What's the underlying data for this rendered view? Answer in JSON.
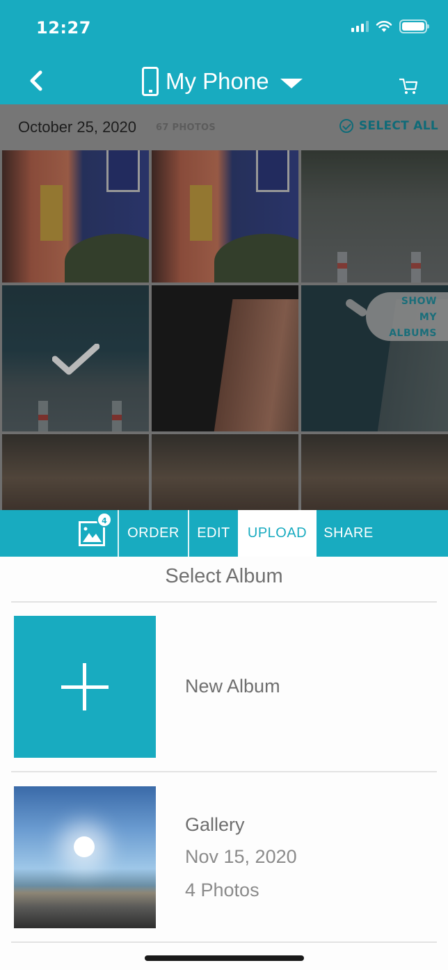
{
  "status_bar": {
    "time": "12:27"
  },
  "header": {
    "title": "My Phone",
    "back_icon": "chevron-left-icon",
    "device_icon": "phone-icon",
    "dropdown_icon": "caret-down-icon",
    "cart_icon": "cart-icon"
  },
  "photo_browser": {
    "date": "October 25, 2020",
    "count": "67 PHOTOS",
    "select_all": "SELECT ALL",
    "show_albums": [
      "SHOW",
      "MY",
      "ALBUMS"
    ],
    "selected_photo_index": 3,
    "photos": [
      "taco-storefront",
      "taco-storefront",
      "night-walkway",
      "string-lights-walkway",
      "brick-tower",
      "brick-tower",
      "hotel-plaza",
      "hotel-plaza",
      "hotel-plaza"
    ]
  },
  "toolbar": {
    "selected_count": "4",
    "items": [
      {
        "label": "ORDER"
      },
      {
        "label": "EDIT"
      },
      {
        "label": "UPLOAD",
        "active": true
      },
      {
        "label": "SHARE"
      }
    ]
  },
  "albums": {
    "title": "Select Album",
    "new_album_label": "New Album",
    "list": [
      {
        "name": "Gallery",
        "date": "Nov 15, 2020",
        "count": "4 Photos"
      }
    ]
  },
  "colors": {
    "brand": "#18abc0",
    "select_all": "#0f6b78",
    "text_gray": "#707070"
  }
}
